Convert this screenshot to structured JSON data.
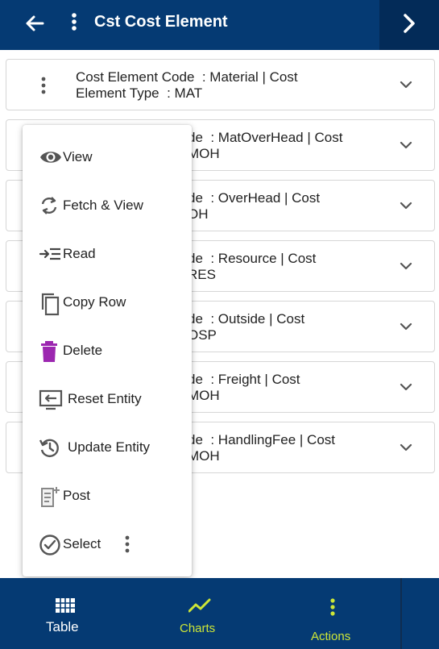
{
  "header": {
    "title": "Cst Cost Element",
    "back_icon": "arrow-left-icon",
    "menu_icon": "more-vertical-icon",
    "next_icon": "chevron-right-icon"
  },
  "rows": [
    {
      "line1": "Cost Element Code  : Material | Cost",
      "line2": "Element Type  : MAT"
    },
    {
      "line1": "de  : MatOverHead | Cost",
      "line2": "MOH"
    },
    {
      "line1": "de  : OverHead | Cost",
      "line2": "OH"
    },
    {
      "line1": "de  : Resource | Cost",
      "line2": "RES"
    },
    {
      "line1": "de  : Outside | Cost",
      "line2": "OSP"
    },
    {
      "line1": "de  : Freight | Cost",
      "line2": "MOH"
    },
    {
      "line1": "de  : HandlingFee | Cost",
      "line2": "MOH"
    }
  ],
  "menu": {
    "items": [
      {
        "label": "View",
        "icon": "eye-icon"
      },
      {
        "label": "Fetch & View",
        "icon": "refresh-icon"
      },
      {
        "label": "Read",
        "icon": "read-icon"
      },
      {
        "label": "Copy Row",
        "icon": "copy-icon"
      },
      {
        "label": "Delete",
        "icon": "trash-icon"
      },
      {
        "label": "Reset Entity",
        "icon": "reset-icon"
      },
      {
        "label": "Update Entity",
        "icon": "update-icon"
      },
      {
        "label": "Post",
        "icon": "post-icon"
      },
      {
        "label": "Select",
        "icon": "check-circle-icon"
      }
    ]
  },
  "bottom_tabs": {
    "table": "Table",
    "charts": "Charts",
    "actions": "Actions"
  },
  "colors": {
    "primary": "#053a73",
    "accent": "#cde637",
    "delete_icon": "#9c27b0"
  }
}
